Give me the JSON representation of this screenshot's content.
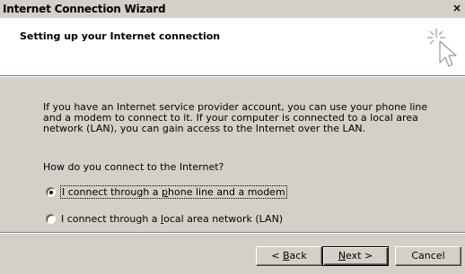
{
  "window": {
    "title": "Internet Connection Wizard",
    "close_glyph": "×"
  },
  "header": {
    "heading": "Setting up your Internet connection",
    "icon": "wizard-sparkle-cursor-icon"
  },
  "body": {
    "paragraph": "If you have an Internet service provider account, you can use your phone line and a modem to connect to it. If your computer is connected to a local area network (LAN), you can gain access to the Internet over the LAN.",
    "question": "How do you connect to the Internet?"
  },
  "options": [
    {
      "pre": "I connect through a ",
      "accel": "p",
      "post": "hone line and a modem",
      "selected": true
    },
    {
      "pre": "I connect through a ",
      "accel": "l",
      "post": "ocal area network (LAN)",
      "selected": false
    }
  ],
  "buttons": {
    "back_pre": "< ",
    "back_accel": "B",
    "back_post": "ack",
    "next_accel": "N",
    "next_post": "ext >",
    "cancel": "Cancel"
  }
}
